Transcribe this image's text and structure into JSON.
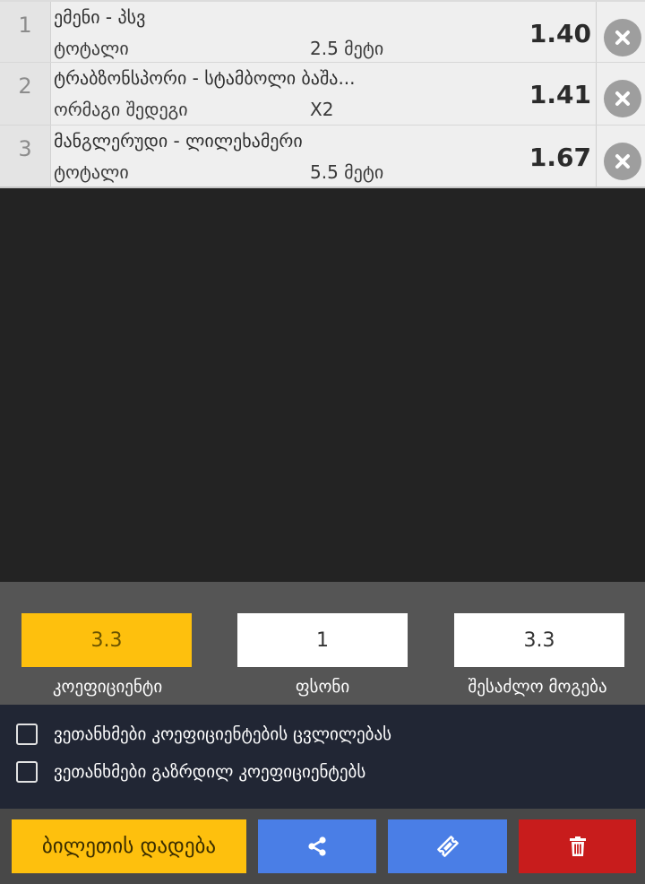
{
  "bets": [
    {
      "index": "1",
      "event": "ემენი - პსვ",
      "market": "ტოტალი",
      "selection": "2.5 მეტი",
      "odds": "1.40"
    },
    {
      "index": "2",
      "event": "ტრაბზონსპორი - სტამბოლი ბაშა...",
      "market": "ორმაგი შედეგი",
      "selection": "X2",
      "odds": "1.41"
    },
    {
      "index": "3",
      "event": "მანგლერუდი - ლილეხამერი",
      "market": "ტოტალი",
      "selection": "5.5 მეტი",
      "odds": "1.67"
    }
  ],
  "totals": {
    "odds_value": "3.3",
    "odds_label": "კოეფიციენტი",
    "stake_value": "1",
    "stake_label": "ფსონი",
    "win_value": "3.3",
    "win_label": "შესაძლო მოგება"
  },
  "options": {
    "accept_changes": "ვეთანხმები კოეფიციენტების ცვლილებას",
    "accept_boosted": "ვეთანხმები გაზრდილ კოეფიციენტებს"
  },
  "actions": {
    "place_bet": "ბილეთის დადება"
  },
  "icons": {
    "remove": "close-circle-icon",
    "share": "share-icon",
    "ticket": "ticket-icon",
    "delete": "trash-icon"
  },
  "colors": {
    "accent_yellow": "#fec00d",
    "action_blue": "#4a7ee6",
    "danger_red": "#c81c1c"
  }
}
